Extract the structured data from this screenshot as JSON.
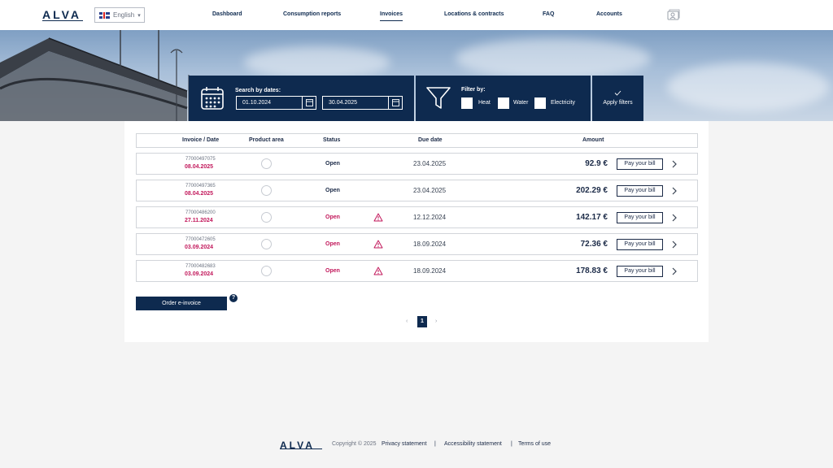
{
  "header": {
    "logo": "ALVA",
    "language": "English",
    "nav": [
      {
        "label": "Dashboard",
        "active": false
      },
      {
        "label": "Consumption reports",
        "active": false
      },
      {
        "label": "Invoices",
        "active": true
      },
      {
        "label": "Locations & contracts",
        "active": false
      },
      {
        "label": "FAQ",
        "active": false
      },
      {
        "label": "Accounts",
        "active": false
      }
    ],
    "account_icon": "user-card-icon"
  },
  "filters": {
    "date_label": "Search by dates:",
    "date_from": "01.10.2024",
    "date_to": "30.04.2025",
    "calendar_icon": "calendar-icon",
    "filter_icon": "funnel-icon",
    "filter_label": "Filter by:",
    "options": [
      {
        "label": "Heat",
        "checked": false
      },
      {
        "label": "Water",
        "checked": false
      },
      {
        "label": "Electricity",
        "checked": false
      }
    ],
    "apply_label": "Apply filters",
    "apply_icon": "checkmark-icon"
  },
  "table": {
    "headers": {
      "invoice": "Invoice / Date",
      "product": "Product area",
      "status": "Status",
      "due": "Due date",
      "amount": "Amount"
    },
    "rows": [
      {
        "number": "77000497075",
        "date": "08.04.2025",
        "product_icon": "building-icon",
        "status": "Open",
        "overdue": false,
        "due": "23.04.2025",
        "amount": "92.9 €",
        "pay": "Pay your bill"
      },
      {
        "number": "77000497365",
        "date": "08.04.2025",
        "product_icon": "building-icon",
        "status": "Open",
        "overdue": false,
        "due": "23.04.2025",
        "amount": "202.29 €",
        "pay": "Pay your bill"
      },
      {
        "number": "77000486200",
        "date": "27.11.2024",
        "product_icon": "building-icon",
        "status": "Open",
        "overdue": true,
        "due": "12.12.2024",
        "amount": "142.17 €",
        "pay": "Pay your bill"
      },
      {
        "number": "77000472605",
        "date": "03.09.2024",
        "product_icon": "building-icon",
        "status": "Open",
        "overdue": true,
        "due": "18.09.2024",
        "amount": "72.36 €",
        "pay": "Pay your bill"
      },
      {
        "number": "77000482683",
        "date": "03.09.2024",
        "product_icon": "electricity-icon",
        "status": "Open",
        "overdue": true,
        "due": "18.09.2024",
        "amount": "178.83 €",
        "pay": "Pay your bill"
      }
    ]
  },
  "actions": {
    "order_einvoice": "Order e-invoice",
    "help": "?"
  },
  "pagination": {
    "prev": "‹",
    "current": "1",
    "next": "›"
  },
  "footer": {
    "logo": "ALVA",
    "copyright": "Copyright © 2025",
    "links": [
      "Privacy statement",
      "Accessibility statement",
      "Terms of use"
    ],
    "separator": "|"
  },
  "colors": {
    "brand": "#0e2a4f",
    "overdue": "#c2185b"
  }
}
